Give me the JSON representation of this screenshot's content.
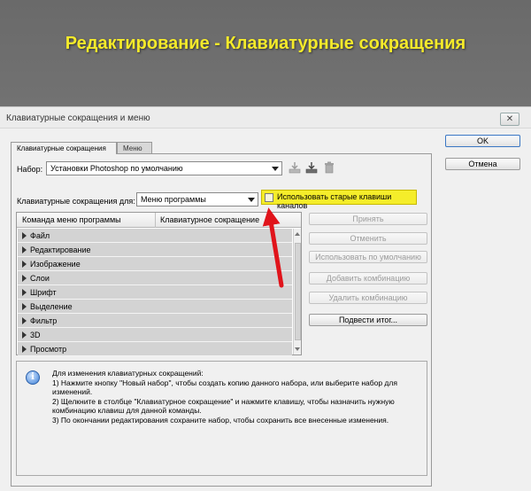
{
  "banner": {
    "title": "Редактирование - Клавиатурные сокращения"
  },
  "dialog": {
    "title": "Клавиатурные сокращения и меню",
    "close_glyph": "✕"
  },
  "tabs": [
    {
      "label": "Клавиатурные сокращения",
      "active": true
    },
    {
      "label": "Меню",
      "active": false
    }
  ],
  "set": {
    "label": "Набор:",
    "value": "Установки Photoshop по умолчанию"
  },
  "shortcuts_for": {
    "label": "Клавиатурные сокращения для:",
    "value": "Меню программы"
  },
  "legacy_checkbox": {
    "label": "Использовать старые клавиши каналов",
    "checked": false
  },
  "table": {
    "columns": [
      "Команда меню программы",
      "Клавиатурное сокращение"
    ],
    "rows": [
      "Файл",
      "Редактирование",
      "Изображение",
      "Слои",
      "Шрифт",
      "Выделение",
      "Фильтр",
      "3D",
      "Просмотр"
    ]
  },
  "buttons": {
    "ok": "OK",
    "cancel": "Отмена",
    "accept": "Принять",
    "undo": "Отменить",
    "use_default": "Использовать по умолчанию",
    "add_shortcut": "Добавить комбинацию",
    "delete_shortcut": "Удалить комбинацию",
    "summarize": "Подвести итог..."
  },
  "info": {
    "lines": [
      "Для изменения клавиатурных сокращений:",
      "1) Нажмите кнопку \"Новый набор\", чтобы создать копию данного набора, или выберите набор для",
      "изменений.",
      "2) Щелкните в столбце \"Клавиатурное сокращение\" и нажмите клавишу, чтобы назначить нужную",
      "комбинацию клавиш для данной команды.",
      "3) По окончании редактирования сохраните набор, чтобы сохранить все внесенные изменения."
    ]
  },
  "icons": {
    "save_set": "save-set-icon",
    "new_set": "new-set-icon",
    "delete_set": "trash-icon",
    "info": "info-icon",
    "annotation": "red-arrow"
  },
  "colors": {
    "banner_bg": "#6e6e6e",
    "banner_text": "#f4ea2a",
    "highlight": "#f5ed2a",
    "arrow": "#e0141b",
    "row_bg": "#d3d3d3"
  }
}
